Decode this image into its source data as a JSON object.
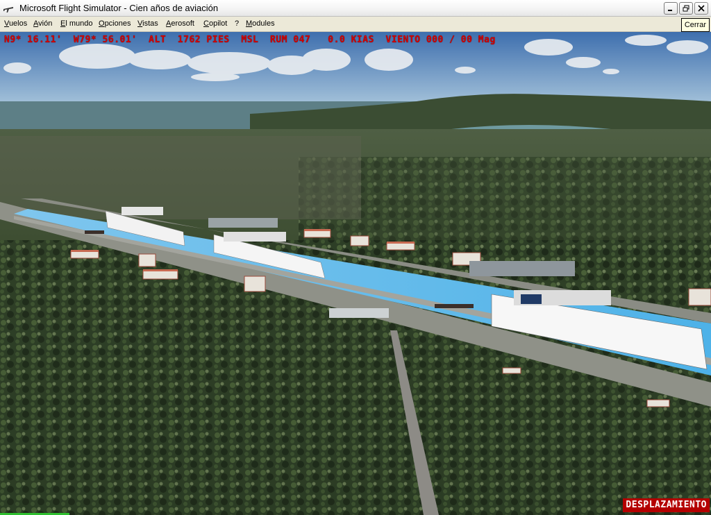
{
  "window": {
    "title": "Microsoft Flight Simulator - Cien años de aviación",
    "controls": {
      "minimize": "minimize",
      "restore": "restore",
      "close": "close",
      "close_tooltip": "Cerrar"
    }
  },
  "menu": {
    "items": [
      "Vuelos",
      "Avión",
      "El mundo",
      "Opciones",
      "Vistas",
      "Aerosoft",
      "Copilot",
      "?",
      "Modules"
    ]
  },
  "hud": {
    "text": "N9* 16.11'  W79* 56.01'  ALT  1762 PIES  MSL  RUM 047   0.0 KIAS  VIENTO 000 / 00 Mag",
    "color": "#d40000"
  },
  "status": {
    "mode": "DESPLAZAMIENTO"
  },
  "icons": {
    "app": "airplane-icon",
    "minimize": "minimize-icon",
    "restore": "restore-icon",
    "close": "close-icon"
  }
}
